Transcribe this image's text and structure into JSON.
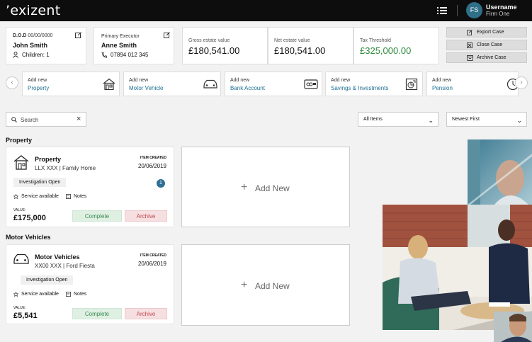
{
  "header": {
    "logo": "’exizent",
    "avatar_initials": "FS",
    "username": "Username",
    "firm": "Firm One"
  },
  "deceased": {
    "dod_label": "D.O.D",
    "dod_value": "00/00/0000",
    "name": "John Smith",
    "children": "Children: 1"
  },
  "executor": {
    "label": "Primary Executor",
    "name": "Anne Smith",
    "phone": "07894 012 345"
  },
  "stats": [
    {
      "label": "Gross estate value",
      "value": "£180,541.00",
      "color": "#111111"
    },
    {
      "label": "Net estate value",
      "value": "£180,541.00",
      "color": "#111111"
    },
    {
      "label": "Tax Threshold",
      "value": "£325,000.00",
      "color": "#2f8a3e"
    }
  ],
  "actions": {
    "export": "Export Case",
    "close": "Close Case",
    "archive": "Archive Case"
  },
  "add_cards": [
    {
      "top": "Add new",
      "label": "Property",
      "icon": "house-icon"
    },
    {
      "top": "Add new",
      "label": "Motor Vehicle",
      "icon": "car-icon"
    },
    {
      "top": "Add new",
      "label": "Bank Account",
      "icon": "bank-card-icon"
    },
    {
      "top": "Add new",
      "label": "Savings & Investments",
      "icon": "savings-icon"
    },
    {
      "top": "Add new",
      "label": "Pension",
      "icon": "pension-icon"
    }
  ],
  "nav": {
    "prev": "‹",
    "next": "›"
  },
  "filters": {
    "search_placeholder": "Search",
    "clear": "×",
    "items": "All Items",
    "sort": "Newest First"
  },
  "sections": [
    {
      "title": "Property",
      "item": {
        "title": "Property",
        "subtitle": "LLX XXX | Family Home",
        "created_label": "ITEM CREATED",
        "created": "20/06/2019",
        "status": "Investigation Open",
        "badge": "1",
        "service": "Service available",
        "notes": "Notes",
        "value_label": "VALUE:",
        "value": "£175,000",
        "complete": "Complete",
        "archive": "Archive"
      },
      "add_new": "Add New"
    },
    {
      "title": "Motor Vehicles",
      "item": {
        "title": "Motor Vehicles",
        "subtitle": "XX00 XXX | Ford Fiesta",
        "created_label": "ITEM CREATED",
        "created": "20/06/2019",
        "status": "Investigation Open",
        "badge": "",
        "service": "Service available",
        "notes": "Notes",
        "value_label": "VALUE:",
        "value": "£5,541",
        "complete": "Complete",
        "archive": "Archive"
      },
      "add_new": "Add New"
    }
  ]
}
